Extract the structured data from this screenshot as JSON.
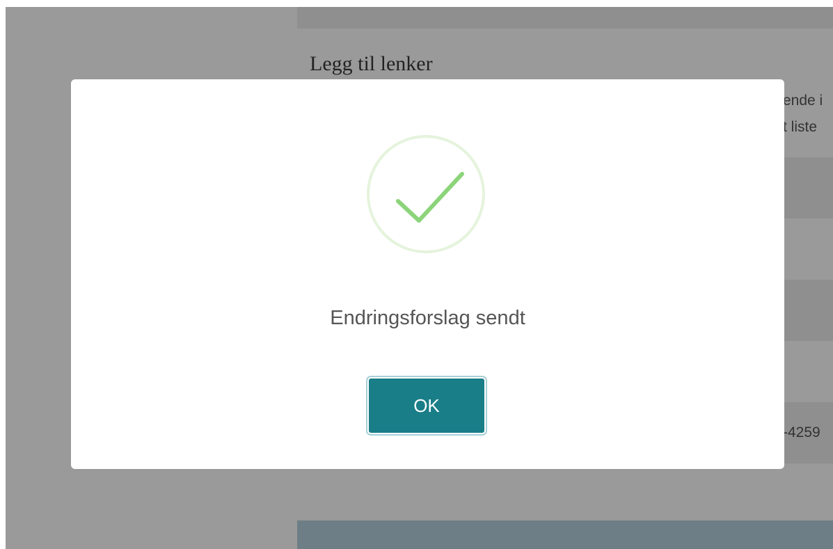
{
  "background": {
    "heading": "Legg til lenker",
    "side_text_line1": "ende i",
    "side_text_line2": "t liste",
    "side_text_line3": "-4259"
  },
  "modal": {
    "message": "Endringsforslag sendt",
    "ok_label": "OK",
    "icon": "success-check-icon"
  },
  "colors": {
    "overlay": "#9a9a9a",
    "success_check": "#8cd47a",
    "success_ring": "#e5f3dc",
    "button_bg": "#197e88",
    "footer_bar": "#6e7e86"
  }
}
